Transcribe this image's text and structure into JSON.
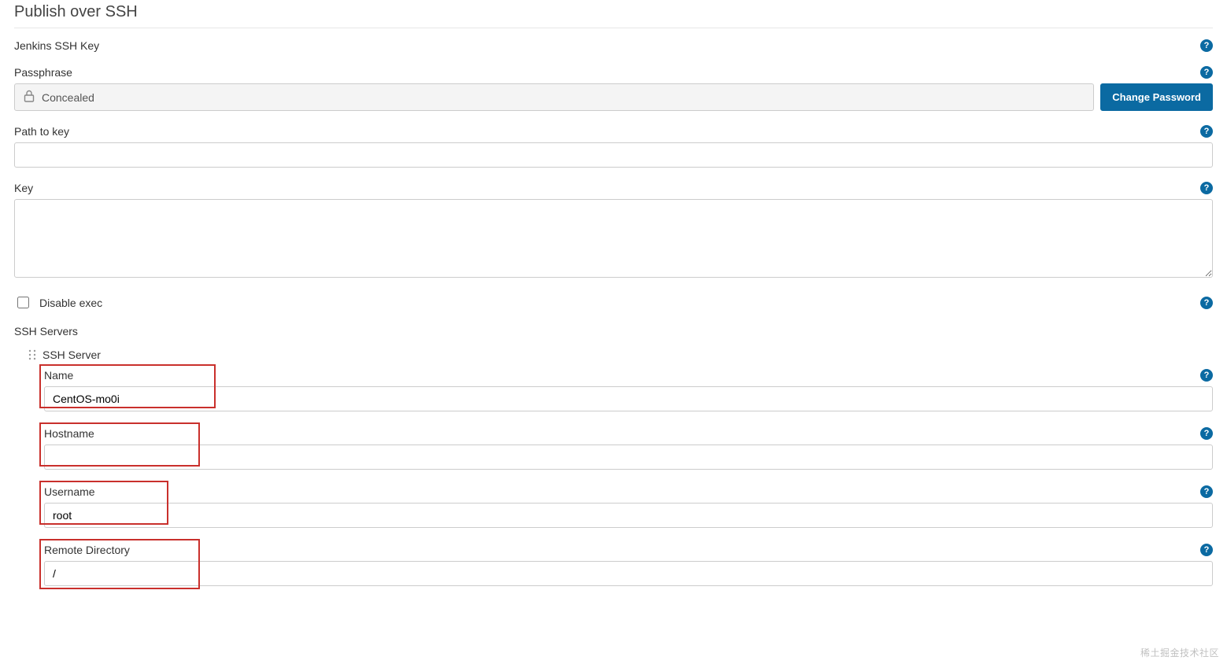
{
  "section": {
    "title": "Publish over SSH"
  },
  "jenkins_key": {
    "label": "Jenkins SSH Key"
  },
  "passphrase": {
    "label": "Passphrase",
    "concealed_text": "Concealed",
    "change_button": "Change Password"
  },
  "path_to_key": {
    "label": "Path to key",
    "value": ""
  },
  "key": {
    "label": "Key",
    "value": ""
  },
  "disable_exec": {
    "label": "Disable exec",
    "checked": false
  },
  "ssh_servers": {
    "label": "SSH Servers",
    "server_header": "SSH Server",
    "server": {
      "name": {
        "label": "Name",
        "value": "CentOS-mo0i"
      },
      "hostname": {
        "label": "Hostname",
        "value": ""
      },
      "username": {
        "label": "Username",
        "value": "root"
      },
      "remote_directory": {
        "label": "Remote Directory",
        "value": "/"
      }
    }
  },
  "watermark": "稀土掘金技术社区"
}
